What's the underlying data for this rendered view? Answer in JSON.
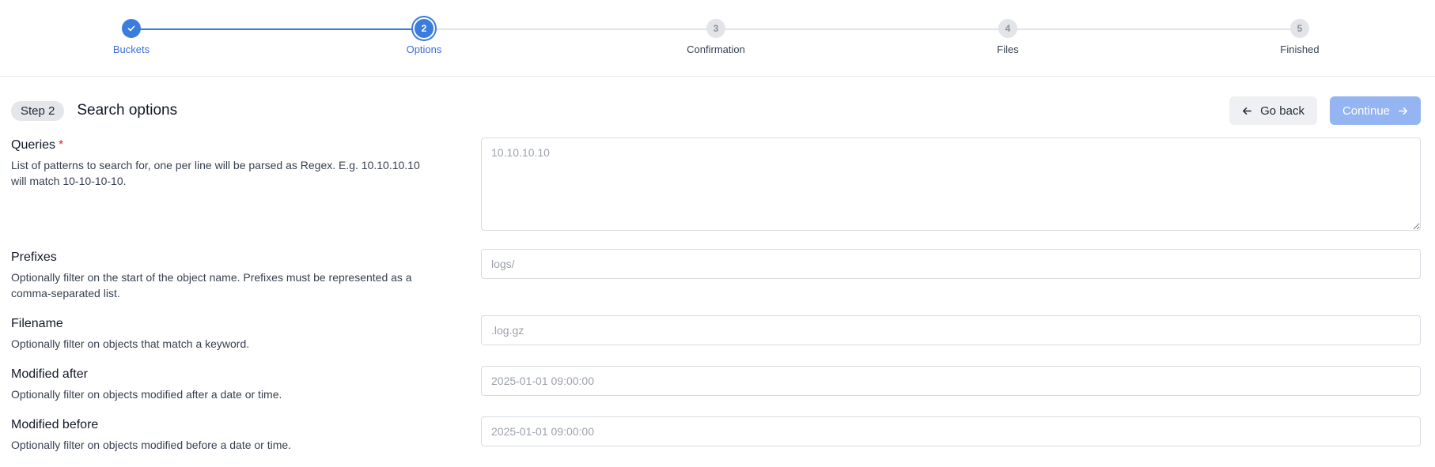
{
  "stepper": {
    "steps": [
      {
        "number": "1",
        "label": "Buckets",
        "state": "done"
      },
      {
        "number": "2",
        "label": "Options",
        "state": "active"
      },
      {
        "number": "3",
        "label": "Confirmation",
        "state": "pending"
      },
      {
        "number": "4",
        "label": "Files",
        "state": "pending"
      },
      {
        "number": "5",
        "label": "Finished",
        "state": "pending"
      }
    ]
  },
  "header": {
    "step_badge": "Step 2",
    "title": "Search options",
    "back_label": "Go back",
    "continue_label": "Continue"
  },
  "form": {
    "queries": {
      "label": "Queries",
      "required_mark": "*",
      "description": "List of patterns to search for, one per line will be parsed as Regex. E.g. 10.10.10.10 will match 10-10-10-10.",
      "placeholder": "10.10.10.10"
    },
    "prefixes": {
      "label": "Prefixes",
      "description": "Optionally filter on the start of the object name. Prefixes must be represented as a comma-separated list.",
      "placeholder": "logs/"
    },
    "filename": {
      "label": "Filename",
      "description": "Optionally filter on objects that match a keyword.",
      "placeholder": ".log.gz"
    },
    "modified_after": {
      "label": "Modified after",
      "description": "Optionally filter on objects modified after a date or time.",
      "placeholder": "2025-01-01 09:00:00"
    },
    "modified_before": {
      "label": "Modified before",
      "description": "Optionally filter on objects modified before a date or time.",
      "placeholder": "2025-01-01 09:00:00"
    }
  },
  "colors": {
    "accent": "#3b7ddd",
    "accent_disabled": "#94b4f2",
    "required": "#dc2626"
  },
  "icons": {
    "step_done": "check-icon",
    "back": "arrow-left-icon",
    "continue": "arrow-right-icon"
  }
}
